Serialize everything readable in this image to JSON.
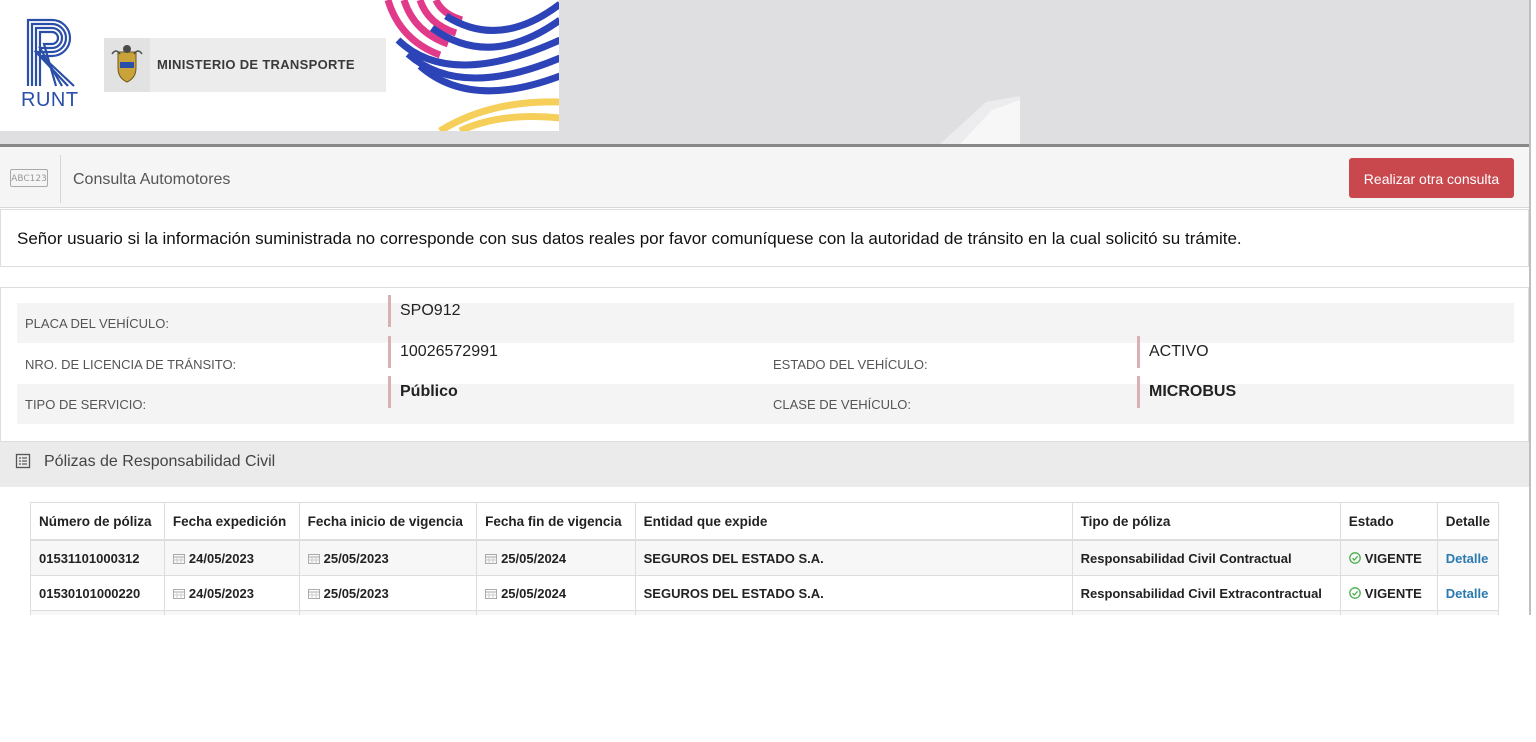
{
  "header": {
    "logo_text": "RUNT",
    "ministry_text": "MINISTERIO DE TRANSPORTE"
  },
  "consulta": {
    "plate_icon_text": "ABC123",
    "title": "Consulta Automotores",
    "button_label": "Realizar otra consulta"
  },
  "notice": "Señor usuario si la información suministrada no corresponde con sus datos reales por favor comuníquese con la autoridad de tránsito en la cual solicitó su trámite.",
  "vehicle": {
    "placa_label": "PLACA DEL VEHÍCULO:",
    "placa_value": "SPO912",
    "licencia_label": "NRO. DE LICENCIA DE TRÁNSITO:",
    "licencia_value": "10026572991",
    "estado_label": "ESTADO DEL VEHÍCULO:",
    "estado_value": "ACTIVO",
    "servicio_label": "TIPO DE SERVICIO:",
    "servicio_value": "Público",
    "clase_label": "CLASE DE VEHÍCULO:",
    "clase_value": "MICROBUS"
  },
  "polizas": {
    "title": "Pólizas de Responsabilidad Civil",
    "columns": [
      "Número de póliza",
      "Fecha expedición",
      "Fecha inicio de vigencia",
      "Fecha fin de vigencia",
      "Entidad que expide",
      "Tipo de póliza",
      "Estado",
      "Detalle"
    ],
    "rows": [
      {
        "numero": "01531101000312",
        "expedicion": "24/05/2023",
        "inicio": "25/05/2023",
        "fin": "25/05/2024",
        "entidad": "SEGUROS DEL ESTADO S.A.",
        "tipo": "Responsabilidad Civil Contractual",
        "estado": "VIGENTE",
        "detalle": "Detalle"
      },
      {
        "numero": "01530101000220",
        "expedicion": "24/05/2023",
        "inicio": "25/05/2023",
        "fin": "25/05/2024",
        "entidad": "SEGUROS DEL ESTADO S.A.",
        "tipo": "Responsabilidad Civil Extracontractual",
        "estado": "VIGENTE",
        "detalle": "Detalle"
      }
    ]
  },
  "colors": {
    "button": "#c9484e",
    "link": "#2a7ab0",
    "status_ok": "#4caf50",
    "runt_blue": "#2a4fa8"
  }
}
